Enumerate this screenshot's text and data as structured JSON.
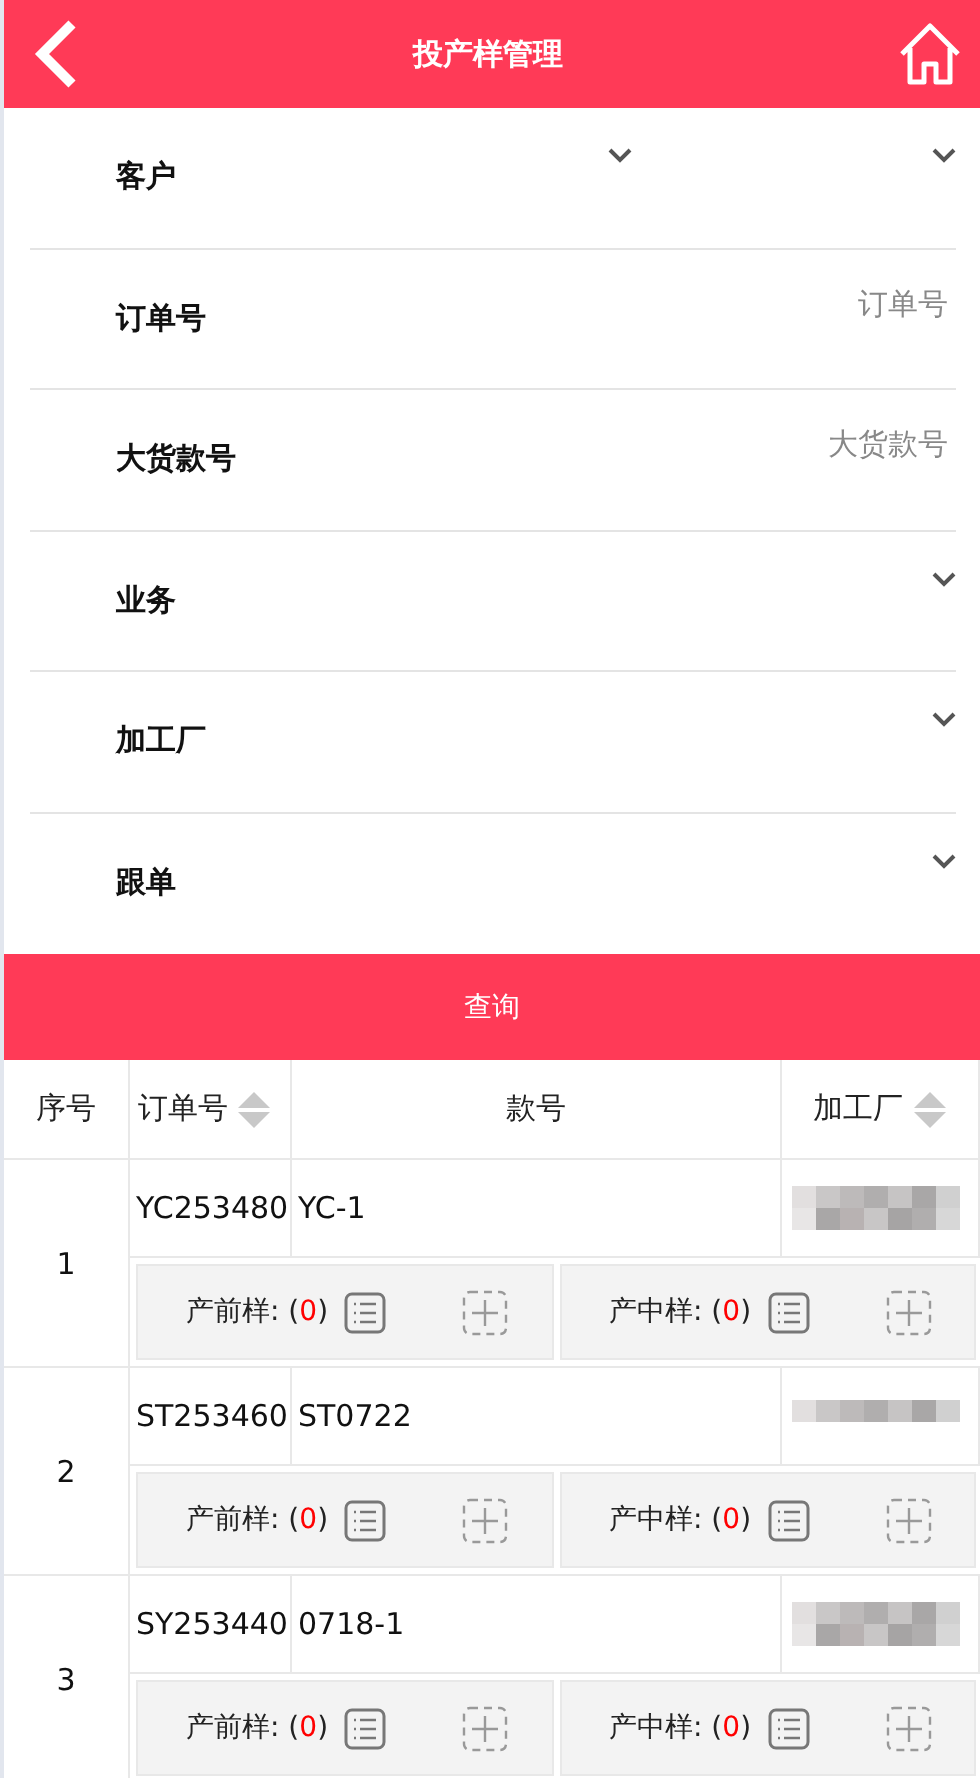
{
  "header": {
    "title": "投产样管理"
  },
  "filters": [
    {
      "kind": "select",
      "label": "客户",
      "extra_chevron": true
    },
    {
      "kind": "input",
      "label": "订单号",
      "placeholder": "订单号"
    },
    {
      "kind": "input",
      "label": "大货款号",
      "placeholder": "大货款号"
    },
    {
      "kind": "select",
      "label": "业务",
      "extra_chevron": false
    },
    {
      "kind": "select",
      "label": "加工厂",
      "extra_chevron": false
    },
    {
      "kind": "select",
      "label": "跟单",
      "extra_chevron": false
    }
  ],
  "query_button": "查询",
  "table": {
    "columns": [
      {
        "label": "序号",
        "sortable": false
      },
      {
        "label": "订单号",
        "sortable": true
      },
      {
        "label": "款号",
        "sortable": false
      },
      {
        "label": "加工厂",
        "sortable": true
      }
    ],
    "rows": [
      {
        "index": "1",
        "order_no": "YC253480",
        "style_no": "YC-1",
        "samples": [
          {
            "label": "产前样:",
            "open": "(",
            "count": "0",
            "close": ")"
          },
          {
            "label": "产中样:",
            "open": "(",
            "count": "0",
            "close": ")"
          }
        ]
      },
      {
        "index": "2",
        "order_no": "ST253460",
        "style_no": "ST0722",
        "samples": [
          {
            "label": "产前样:",
            "open": "(",
            "count": "0",
            "close": ")"
          },
          {
            "label": "产中样:",
            "open": "(",
            "count": "0",
            "close": ")"
          }
        ]
      },
      {
        "index": "3",
        "order_no": "SY253440",
        "style_no": "0718-1",
        "samples": [
          {
            "label": "产前样:",
            "open": "(",
            "count": "0",
            "close": ")"
          },
          {
            "label": "产中样:",
            "open": "(",
            "count": "0",
            "close": ")"
          }
        ]
      }
    ]
  }
}
